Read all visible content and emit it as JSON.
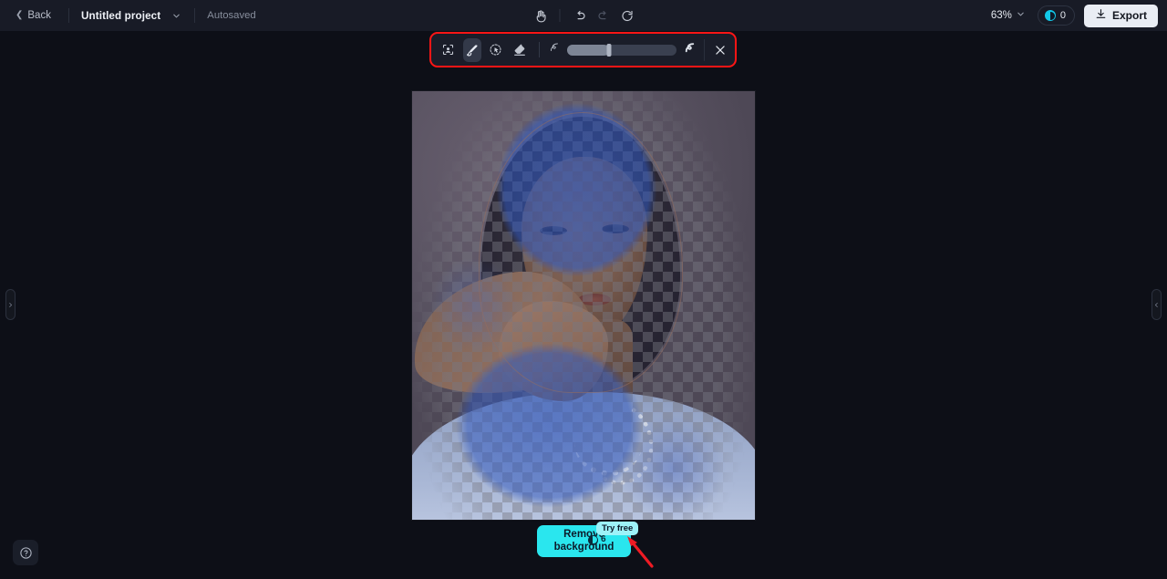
{
  "topbar": {
    "back_label": "Back",
    "project_title": "Untitled project",
    "autosaved_label": "Autosaved",
    "hand_tool": "hand-tool",
    "undo": "undo",
    "redo": "redo",
    "refresh": "refresh",
    "zoom_level": "63%",
    "credits_count": "0",
    "export_label": "Export"
  },
  "toolbar": {
    "tools": [
      {
        "name": "select-subject-tool",
        "label": "Select subject"
      },
      {
        "name": "brush-tool",
        "label": "Brush",
        "active": true
      },
      {
        "name": "magic-select-tool",
        "label": "Magic select"
      },
      {
        "name": "eraser-tool",
        "label": "Eraser"
      }
    ],
    "brush_size_small_label": "Small brush",
    "brush_size_large_label": "Large brush",
    "brush_size_value": "38",
    "close_label": "Close"
  },
  "canvas": {
    "image_alt": "Portrait of a woman with selection mask and transparency checkerboard",
    "left_panel_toggle": "Expand left panel",
    "right_panel_toggle": "Expand right panel"
  },
  "cta": {
    "remove_background_label": "Remove background",
    "cost_value": "6",
    "try_free_label": "Try free"
  },
  "help": {
    "label": "Help"
  },
  "colors": {
    "accent_cyan": "#2ae6ee",
    "annotation_red": "#ff1515",
    "export_bg": "#e9edf4",
    "topbar_bg": "#181b26",
    "app_bg": "#0d0f17"
  }
}
